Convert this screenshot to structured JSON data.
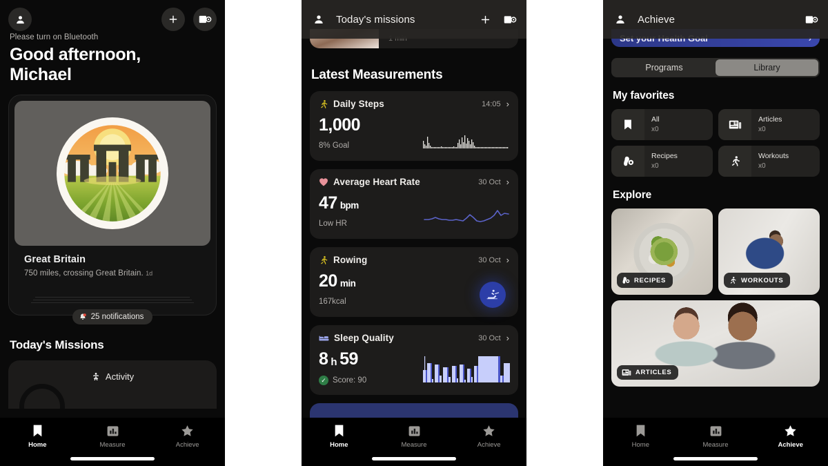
{
  "panel1": {
    "appbar": {
      "avatar_icon": "person-icon",
      "add_icon": "plus-icon",
      "scan_icon": "scan-device-icon"
    },
    "bluetooth_note": "Please turn on Bluetooth",
    "greeting_line1": "Good afternoon,",
    "greeting_line2": "Michael",
    "journey": {
      "image_alt": "stonehenge-sunrise-badge",
      "title": "Great Britain",
      "subtitle": "750 miles, crossing Great Britain.",
      "time_ago": "1d"
    },
    "notifications": {
      "icon": "bell-icon",
      "label": "25 notifications"
    },
    "missions_title": "Today's Missions",
    "mission": {
      "icon": "activity-person-icon",
      "label": "Activity"
    },
    "nav": [
      {
        "name": "home",
        "label": "Home",
        "icon": "bookmark-icon",
        "active": true
      },
      {
        "name": "measure",
        "label": "Measure",
        "icon": "bar-chart-icon",
        "active": false
      },
      {
        "name": "achieve",
        "label": "Achieve",
        "icon": "star-icon",
        "active": false
      }
    ]
  },
  "panel2": {
    "appbar": {
      "title": "Today's missions",
      "avatar_icon": "person-icon",
      "add_icon": "plus-icon",
      "scan_icon": "scan-device-icon"
    },
    "partial_card": {
      "duration": "1 min"
    },
    "section_title": "Latest Measurements",
    "measurements": [
      {
        "name": "Daily Steps",
        "icon": "running-person-icon",
        "icon_color": "#d9c221",
        "date": "14:05",
        "value": "1,000",
        "unit": "",
        "footer": "8% Goal",
        "graph": "bar-sparkline"
      },
      {
        "name": "Average Heart Rate",
        "icon": "heart-icon",
        "icon_color": "#e8929a",
        "date": "30 Oct",
        "value": "47",
        "unit": "bpm",
        "footer": "Low HR",
        "graph": "line-sparkline"
      },
      {
        "name": "Rowing",
        "icon": "running-person-icon",
        "icon_color": "#d9c221",
        "date": "30 Oct",
        "value": "20",
        "unit": "min",
        "footer": "167kcal",
        "graph": "rowing-badge"
      },
      {
        "name": "Sleep Quality",
        "icon": "bed-icon",
        "icon_color": "#9aa4e8",
        "date": "30 Oct",
        "value_hours": "8",
        "value_h_sep": "h",
        "value_minutes": "59",
        "footer": "Score: 90",
        "footer_icon": "check-circle-icon",
        "graph": "sleep-stage-bars"
      }
    ],
    "nav": [
      {
        "name": "home",
        "label": "Home",
        "icon": "bookmark-icon",
        "active": true
      },
      {
        "name": "measure",
        "label": "Measure",
        "icon": "bar-chart-icon",
        "active": false
      },
      {
        "name": "achieve",
        "label": "Achieve",
        "icon": "star-icon",
        "active": false
      }
    ]
  },
  "panel3": {
    "appbar": {
      "title": "Achieve",
      "avatar_icon": "person-icon",
      "scan_icon": "scan-device-icon"
    },
    "goal_banner": {
      "label": "Set your Health Goal",
      "chevron": "chevron-right-icon"
    },
    "segmented": {
      "options": [
        "Programs",
        "Library"
      ],
      "selected": "Library"
    },
    "favorites_title": "My favorites",
    "favorites": [
      {
        "label": "All",
        "count": "x0",
        "icon": "bookmark-icon"
      },
      {
        "label": "Articles",
        "count": "x0",
        "icon": "article-icon"
      },
      {
        "label": "Recipes",
        "count": "x0",
        "icon": "avocado-icon"
      },
      {
        "label": "Workouts",
        "count": "x0",
        "icon": "running-person-icon"
      }
    ],
    "explore_title": "Explore",
    "explore": [
      {
        "label": "RECIPES",
        "icon": "avocado-icon",
        "image_alt": "salad-bowl-photo"
      },
      {
        "label": "WORKOUTS",
        "icon": "running-person-icon",
        "image_alt": "person-stretching-photo"
      },
      {
        "label": "ARTICLES",
        "icon": "article-icon",
        "image_alt": "two-women-sitting-photo"
      }
    ],
    "nav": [
      {
        "name": "home",
        "label": "Home",
        "icon": "bookmark-icon",
        "active": false
      },
      {
        "name": "measure",
        "label": "Measure",
        "icon": "bar-chart-icon",
        "active": false
      },
      {
        "name": "achieve",
        "label": "Achieve",
        "icon": "star-icon",
        "active": true
      }
    ]
  },
  "chart_data": [
    {
      "type": "bar",
      "title": "Daily Steps sparkline",
      "values": [
        6,
        3,
        2,
        9,
        4,
        2,
        1,
        1,
        1,
        1,
        1,
        1,
        1,
        2,
        1,
        1,
        1,
        1,
        1,
        1,
        1,
        1,
        2,
        1,
        1,
        4,
        7,
        3,
        9,
        5,
        11,
        4,
        9,
        6,
        3,
        8,
        5,
        2,
        1,
        1,
        1,
        1,
        1,
        1,
        1,
        1,
        1,
        1,
        1,
        1,
        1,
        1,
        1,
        1,
        1,
        1,
        1,
        1,
        1,
        1
      ],
      "ylim": [
        0,
        12
      ],
      "grid": false
    },
    {
      "type": "line",
      "title": "Average Heart Rate sparkline",
      "values": [
        47,
        47,
        48,
        49,
        48,
        47,
        47,
        46,
        46,
        47,
        46,
        45,
        48,
        52,
        49,
        45,
        44,
        45,
        47,
        48,
        50,
        56,
        50,
        52
      ],
      "ylim": [
        42,
        58
      ],
      "grid": false
    },
    {
      "type": "bar",
      "title": "Sleep Quality stage bars",
      "values": [
        10,
        3,
        30,
        1,
        28,
        5,
        24,
        4,
        26,
        3,
        27,
        2,
        22,
        4,
        25,
        2,
        28,
        3,
        26,
        3,
        22,
        5,
        26,
        2,
        40,
        40,
        40,
        40,
        6,
        30,
        30
      ],
      "ylim": [
        0,
        42
      ],
      "grid": false
    }
  ]
}
